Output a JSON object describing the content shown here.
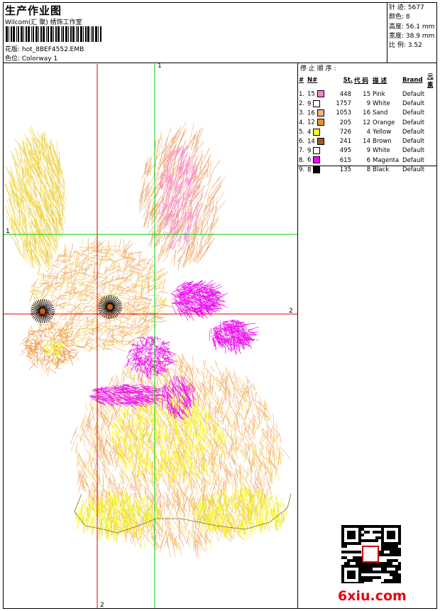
{
  "header": {
    "title": "生产作业图",
    "studio": "Wilcom(汇 聚) 绣饰工作室",
    "design_label": "花版: hot_8BEF4552.EMB",
    "colorway_label": "色位: Colorway 1"
  },
  "stats": [
    {
      "label": "针 迹:",
      "value": "5677"
    },
    {
      "label": "颜色:",
      "value": "8"
    },
    {
      "label": "高度:",
      "value": "56.1 mm"
    },
    {
      "label": "宽度:",
      "value": "38.9 mm"
    },
    {
      "label": "比 例:",
      "value": "3.52"
    }
  ],
  "stop_sequence": {
    "title": "停 止 顺 序 :",
    "headers": [
      "#",
      "N#",
      "St.",
      "代 码",
      "描 述",
      "Brand",
      "元 素"
    ],
    "rows": [
      {
        "idx": "1.",
        "n": "15",
        "color": "#ff7fc8",
        "st": "448",
        "code": "15",
        "desc": "Pink",
        "brand": "Default"
      },
      {
        "idx": "2.",
        "n": "9",
        "color": "#ffffff",
        "st": "1757",
        "code": "9",
        "desc": "White",
        "brand": "Default"
      },
      {
        "idx": "3.",
        "n": "16",
        "color": "#f5b07a",
        "st": "1053",
        "code": "16",
        "desc": "Sand",
        "brand": "Default"
      },
      {
        "idx": "4.",
        "n": "12",
        "color": "#f28a2e",
        "st": "205",
        "code": "12",
        "desc": "Orange",
        "brand": "Default"
      },
      {
        "idx": "5.",
        "n": "4",
        "color": "#ffff00",
        "st": "726",
        "code": "4",
        "desc": "Yellow",
        "brand": "Default"
      },
      {
        "idx": "6.",
        "n": "14",
        "color": "#9c5a2a",
        "st": "241",
        "code": "14",
        "desc": "Brown",
        "brand": "Default"
      },
      {
        "idx": "7.",
        "n": "9",
        "color": "#ffffff",
        "st": "495",
        "code": "9",
        "desc": "White",
        "brand": "Default"
      },
      {
        "idx": "8.",
        "n": "6",
        "color": "#ff00ff",
        "st": "615",
        "code": "6",
        "desc": "Magenta",
        "brand": "Default"
      },
      {
        "idx": "9.",
        "n": "8",
        "color": "#000000",
        "st": "135",
        "code": "8",
        "desc": "Black",
        "brand": "Default"
      }
    ]
  },
  "guides": {
    "top_green": "1",
    "left_green": "1",
    "right_red": "2",
    "bottom_red": "2"
  },
  "watermark": "6xiu.com",
  "qr_seal": "汇聚"
}
